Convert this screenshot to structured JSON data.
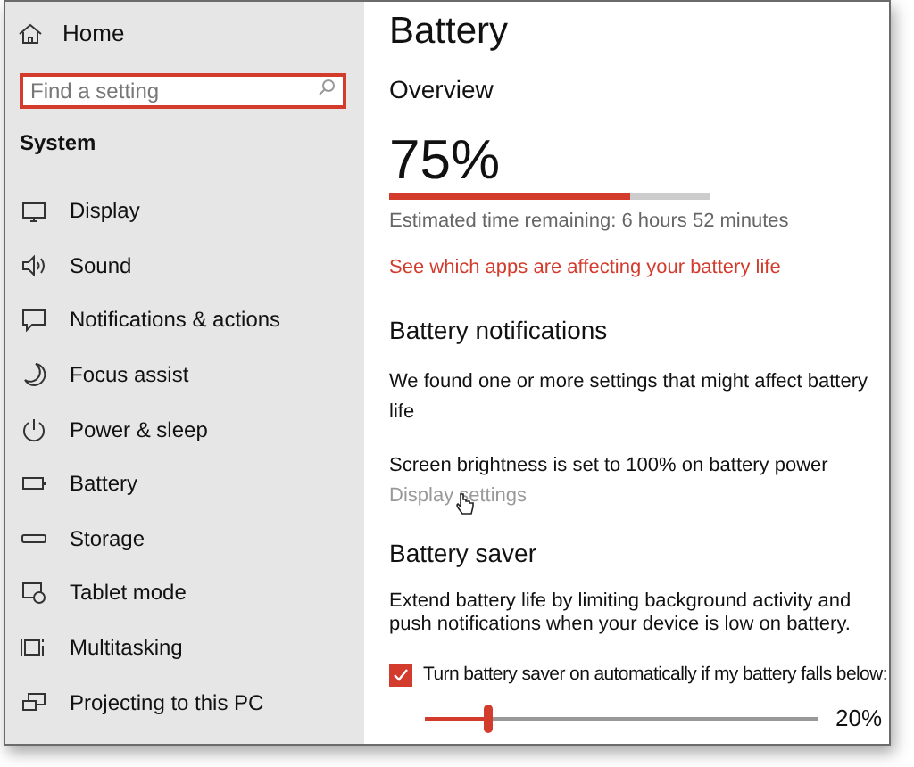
{
  "sidebar": {
    "home": {
      "label": "Home"
    },
    "search": {
      "placeholder": "Find a setting"
    },
    "section": "System",
    "items": [
      {
        "label": "Display",
        "selected": false
      },
      {
        "label": "Sound",
        "selected": false
      },
      {
        "label": "Notifications & actions",
        "selected": false
      },
      {
        "label": "Focus assist",
        "selected": false
      },
      {
        "label": "Power & sleep",
        "selected": false
      },
      {
        "label": "Battery",
        "selected": false
      },
      {
        "label": "Storage",
        "selected": false
      },
      {
        "label": "Tablet mode",
        "selected": false
      },
      {
        "label": "Multitasking",
        "selected": false
      },
      {
        "label": "Projecting to this PC",
        "selected": false
      }
    ]
  },
  "page": {
    "title": "Battery",
    "overview": {
      "heading": "Overview",
      "percent": "75%",
      "level": 0.75,
      "estimate": "Estimated time remaining: 6 hours 52 minutes",
      "link": "See which apps are affecting your battery life"
    },
    "notifications": {
      "heading": "Battery notifications",
      "message": "We found one or more settings that might affect battery life",
      "issue": "Screen brightness is set to 100% on battery power",
      "link": "Display settings"
    },
    "saver": {
      "heading": "Battery saver",
      "description": "Extend battery life by limiting background activity and push notifications when your device is low on battery.",
      "checkbox": {
        "label": "Turn battery saver on automatically if my battery falls below:",
        "checked": true
      },
      "slider": {
        "level": 0.16,
        "reading": "20%"
      }
    }
  }
}
